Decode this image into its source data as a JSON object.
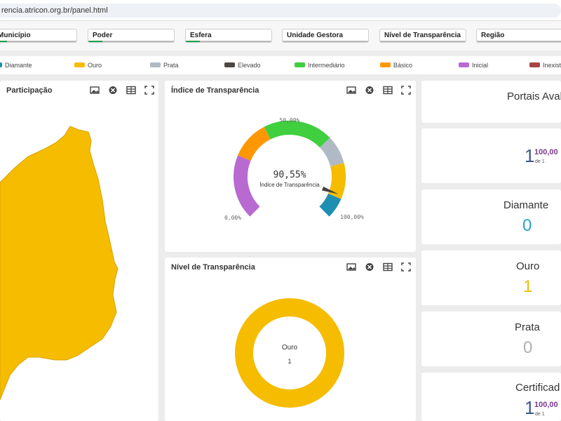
{
  "browser": {
    "url": "rencia.atricon.org.br/panel.html"
  },
  "filters": [
    {
      "label": "Município"
    },
    {
      "label": "Poder"
    },
    {
      "label": "Esfera"
    },
    {
      "label": "Unidade Gestora"
    },
    {
      "label": "Nível de Transparência"
    },
    {
      "label": "Região"
    }
  ],
  "legend": [
    {
      "label": "Diamante",
      "color": "#1e8fb3"
    },
    {
      "label": "Ouro",
      "color": "#f5bc00"
    },
    {
      "label": "Prata",
      "color": "#b0bac4"
    },
    {
      "label": "Elevado",
      "color": "#4d4641"
    },
    {
      "label": "Intermediário",
      "color": "#3fcf3f"
    },
    {
      "label": "Básico",
      "color": "#ff9800"
    },
    {
      "label": "Inicial",
      "color": "#b86ad1"
    },
    {
      "label": "Inexistente",
      "color": "#a84444"
    }
  ],
  "map_panel": {
    "title": "Participação",
    "fill_color": "#f5bc00"
  },
  "gauge_panel": {
    "title": "Índice de Transparência",
    "value_text": "90,55%",
    "value_label": "Índice de Transparência",
    "min_label": "0,00%",
    "mid_label": "50,00%",
    "max_label": "100,00%"
  },
  "donut_panel": {
    "title": "Nível de Transparência",
    "center_label": "Ouro",
    "center_value": "1",
    "color": "#f5bc00"
  },
  "stats": {
    "portais": {
      "title": "Portais Aval"
    },
    "kpi1": {
      "number": "1",
      "percent": "100,00",
      "sub": "de 1"
    },
    "diamante": {
      "title": "Diamante",
      "value": "0",
      "color": "#2aa1c8"
    },
    "ouro": {
      "title": "Ouro",
      "value": "1",
      "color": "#f5bc00"
    },
    "prata": {
      "title": "Prata",
      "value": "0",
      "color": "#b0b0b0"
    },
    "certificados": {
      "title": "Certificad",
      "number": "1",
      "percent": "100,00",
      "sub": "de 1"
    }
  },
  "chart_data": [
    {
      "type": "gauge",
      "title": "Índice de Transparência",
      "value": 90.55,
      "range": [
        0,
        100
      ],
      "segments": [
        {
          "name": "Inicial",
          "from": 0,
          "to": 25,
          "color": "#b86ad1"
        },
        {
          "name": "Básico",
          "from": 25,
          "to": 40,
          "color": "#ff9800"
        },
        {
          "name": "Intermediário",
          "from": 40,
          "to": 67,
          "color": "#3fcf3f"
        },
        {
          "name": "Prata",
          "from": 67,
          "to": 78,
          "color": "#b0bac4"
        },
        {
          "name": "Ouro",
          "from": 78,
          "to": 92,
          "color": "#f5bc00"
        },
        {
          "name": "Diamante",
          "from": 92,
          "to": 100,
          "color": "#1e8fb3"
        }
      ]
    },
    {
      "type": "pie",
      "title": "Nível de Transparência",
      "categories": [
        "Ouro"
      ],
      "values": [
        1
      ],
      "colors": [
        "#f5bc00"
      ]
    }
  ]
}
